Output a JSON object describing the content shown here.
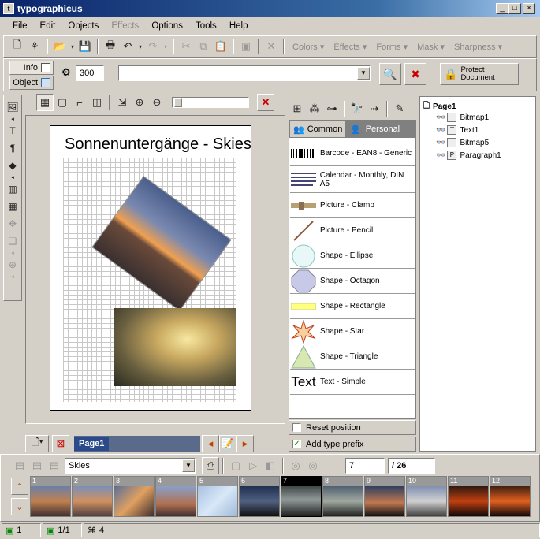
{
  "window": {
    "title": "typographicus"
  },
  "menu": [
    "File",
    "Edit",
    "Objects",
    "Effects",
    "Options",
    "Tools",
    "Help"
  ],
  "toolbar_dropdowns": [
    "Colors",
    "Effects",
    "Forms",
    "Mask",
    "Sharpness"
  ],
  "props": {
    "info_label": "Info",
    "object_label": "Object",
    "size_value": "300",
    "combo_value": "",
    "protect_label": "Protect Document"
  },
  "document": {
    "title": "Sonnenuntergänge - Skies"
  },
  "page_tab": {
    "label": "Page1"
  },
  "library": {
    "tabs": [
      "Common",
      "Personal"
    ],
    "items": [
      {
        "label": "Barcode - EAN8 - Generic",
        "icon": "barcode-icon"
      },
      {
        "label": "Calendar - Monthly, DIN A5",
        "icon": "calendar-icon"
      },
      {
        "label": "Picture - Clamp",
        "icon": "clamp-icon"
      },
      {
        "label": "Picture - Pencil",
        "icon": "pencil-icon"
      },
      {
        "label": "Shape - Ellipse",
        "icon": "ellipse-icon"
      },
      {
        "label": "Shape - Octagon",
        "icon": "octagon-icon"
      },
      {
        "label": "Shape - Rectangle",
        "icon": "rectangle-icon"
      },
      {
        "label": "Shape - Star",
        "icon": "star-icon"
      },
      {
        "label": "Shape - Triangle",
        "icon": "triangle-icon"
      },
      {
        "label": "Text - Simple",
        "icon": "text-icon",
        "icon_text": "Text"
      }
    ],
    "reset_label": "Reset position",
    "prefix_label": "Add type prefix"
  },
  "tree": {
    "root": "Page1",
    "items": [
      "Bitmap1",
      "Text1",
      "Bitmap5",
      "Paragraph1"
    ]
  },
  "gallery": {
    "album": "Skies",
    "current": "7",
    "total": "/ 26",
    "thumbs": [
      "1",
      "2",
      "3",
      "4",
      "5",
      "6",
      "7",
      "8",
      "9",
      "10",
      "11",
      "12"
    ]
  },
  "statusbar": {
    "a": "1",
    "b": "1/1",
    "c": "4"
  }
}
